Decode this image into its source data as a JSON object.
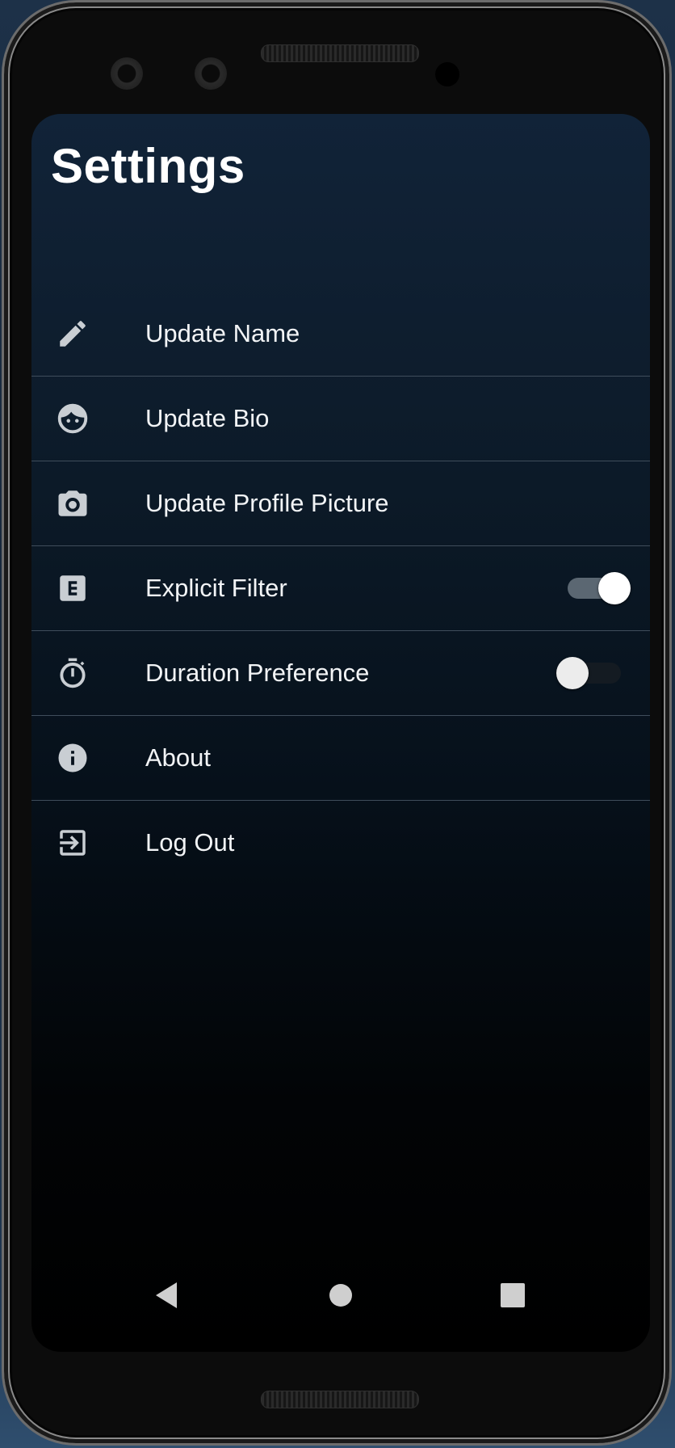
{
  "screen": {
    "title": "Settings"
  },
  "settings": {
    "items": [
      {
        "label": "Update Name",
        "icon": "pencil-icon"
      },
      {
        "label": "Update Bio",
        "icon": "face-icon"
      },
      {
        "label": "Update Profile Picture",
        "icon": "camera-icon"
      },
      {
        "label": "Explicit Filter",
        "icon": "explicit-icon",
        "toggle": true,
        "toggle_on": true
      },
      {
        "label": "Duration Preference",
        "icon": "timer-icon",
        "toggle": true,
        "toggle_on": false
      },
      {
        "label": "About",
        "icon": "info-icon"
      },
      {
        "label": "Log Out",
        "icon": "logout-icon"
      }
    ]
  },
  "navbar": {
    "buttons": [
      "back-icon",
      "home-icon",
      "recents-icon"
    ]
  },
  "colors": {
    "text": "#f2f4f6",
    "icon": "#c9ced3",
    "divider": "#3f4d5b",
    "toggle_on_knob": "#ffffff",
    "toggle_on_track": "#5b6772",
    "toggle_off_knob": "#ececec"
  }
}
